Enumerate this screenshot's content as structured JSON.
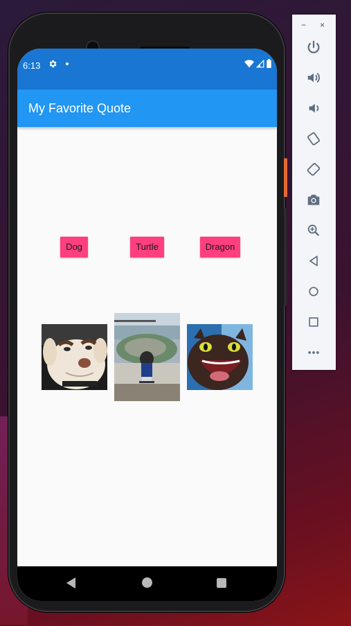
{
  "status_bar": {
    "time": "6:13"
  },
  "app_bar": {
    "title": "My Favorite Quote"
  },
  "buttons": [
    {
      "label": "Dog"
    },
    {
      "label": "Turtle"
    },
    {
      "label": "Dragon"
    }
  ],
  "toolbar": {
    "minimize": "−",
    "close": "×",
    "icons": [
      "power-icon",
      "volume-up-icon",
      "volume-down-icon",
      "rotate-left-icon",
      "rotate-right-icon",
      "camera-icon",
      "zoom-icon",
      "back-icon",
      "home-icon",
      "overview-icon",
      "more-icon"
    ]
  },
  "colors": {
    "status_bar": "#1976d2",
    "app_bar": "#2196f3",
    "button": "#ff3f7f",
    "toolbar_icon": "#5f6e80"
  }
}
